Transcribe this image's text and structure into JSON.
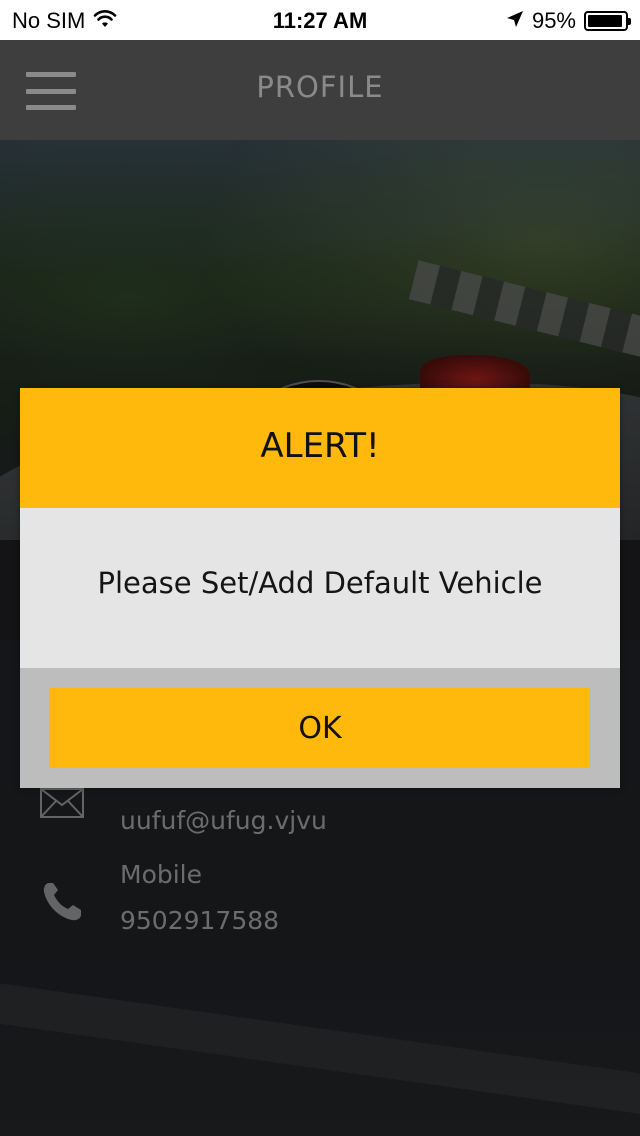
{
  "status_bar": {
    "carrier": "No SIM",
    "time": "11:27 AM",
    "battery_percent": "95%",
    "battery_level": 0.95,
    "icons": [
      "wifi-icon",
      "location-arrow-icon",
      "battery-icon"
    ]
  },
  "header": {
    "title": "PROFILE",
    "menu_icon": "hamburger-menu-icon"
  },
  "profile": {
    "email_icon": "mail-icon",
    "email": "uufuf@ufug.vjvu",
    "mobile_icon": "phone-icon",
    "mobile_label": "Mobile",
    "mobile": "9502917588"
  },
  "alert": {
    "title": "ALERT!",
    "message": "Please Set/Add Default Vehicle",
    "ok_label": "OK"
  },
  "colors": {
    "accent": "#ffb80c",
    "header_bg": "#3e3e3e",
    "dialog_body_bg": "#e5e5e5",
    "dialog_footer_bg": "#bdbdbd"
  }
}
